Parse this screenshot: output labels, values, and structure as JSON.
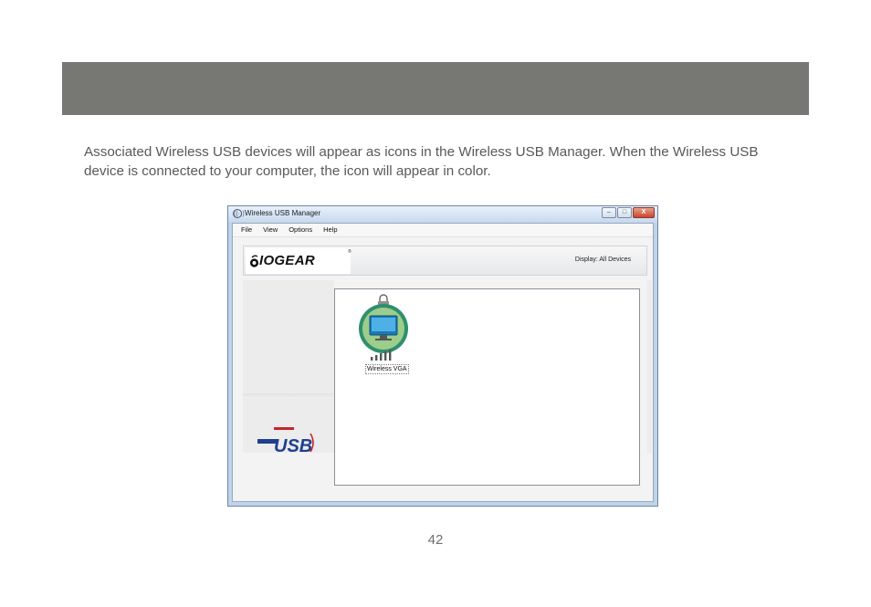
{
  "intro_text": "Associated Wireless USB devices will appear as icons in the Wireless USB Manager. When the Wireless USB device is connected to your computer, the icon will appear in color.",
  "page_number": "42",
  "window": {
    "title": "Wireless USB Manager",
    "controls": {
      "minimize": "–",
      "maximize": "□",
      "close": "X"
    },
    "menu": [
      "File",
      "View",
      "Options",
      "Help"
    ],
    "brand": {
      "logo_text": "IOGEAR",
      "registered": "®"
    },
    "display_filter": "Display:  All Devices",
    "devices": [
      {
        "label": "Wireless VGA",
        "icon": "monitor-icon"
      }
    ],
    "usb_logo": {
      "text": "USB"
    }
  },
  "colors": {
    "header_band": "#777873",
    "device_ring": "#2e8f6e",
    "monitor": "#1a7ab8"
  }
}
